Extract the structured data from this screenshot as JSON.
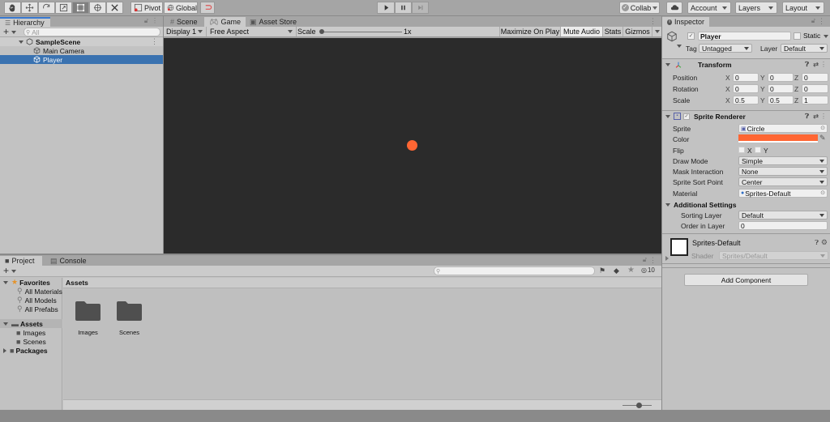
{
  "toolbar": {
    "tools": [
      "hand-tool",
      "move-tool",
      "rotate-tool",
      "scale-tool",
      "rect-tool",
      "transform-tool",
      "custom-tool"
    ],
    "active_tool": "rect-tool",
    "pivot_label": "Pivot",
    "global_label": "Global",
    "play_controls": [
      "play",
      "pause",
      "step"
    ],
    "collab_label": "Collab",
    "account_label": "Account",
    "layers_label": "Layers",
    "layout_label": "Layout"
  },
  "hierarchy": {
    "tab_label": "Hierarchy",
    "search_placeholder": "All",
    "scene_name": "SampleScene",
    "items": [
      {
        "label": "Main Camera",
        "selected": false
      },
      {
        "label": "Player",
        "selected": true
      }
    ]
  },
  "center": {
    "tabs": [
      {
        "label": "Scene",
        "selected": false
      },
      {
        "label": "Game",
        "selected": true
      },
      {
        "label": "Asset Store",
        "selected": false
      }
    ],
    "display_label": "Display 1",
    "aspect_label": "Free Aspect",
    "scale_label": "Scale",
    "scale_value": "1x",
    "maximize_label": "Maximize On Play",
    "mute_label": "Mute Audio",
    "mute_on": true,
    "stats_label": "Stats",
    "gizmos_label": "Gizmos",
    "background_color": "#2b2b2b",
    "sprite_color": "#ff6633"
  },
  "project": {
    "tabs": [
      {
        "label": "Project",
        "selected": true
      },
      {
        "label": "Console",
        "selected": false
      }
    ],
    "favorites_label": "Favorites",
    "favorites": [
      "All Materials",
      "All Models",
      "All Prefabs"
    ],
    "assets_label": "Assets",
    "asset_folders": [
      "Images",
      "Scenes"
    ],
    "packages_label": "Packages",
    "breadcrumb": "Assets",
    "grid_items": [
      "Images",
      "Scenes"
    ],
    "hidden_count": "10"
  },
  "inspector": {
    "tab_label": "Inspector",
    "object_name": "Player",
    "active_checked": true,
    "static_label": "Static",
    "tag_label": "Tag",
    "tag_value": "Untagged",
    "layer_label": "Layer",
    "layer_value": "Default",
    "transform": {
      "title": "Transform",
      "rows": [
        {
          "label": "Position",
          "x": "0",
          "y": "0",
          "z": "0"
        },
        {
          "label": "Rotation",
          "x": "0",
          "y": "0",
          "z": "0"
        },
        {
          "label": "Scale",
          "x": "0.5",
          "y": "0.5",
          "z": "1"
        }
      ]
    },
    "sprite_renderer": {
      "title": "Sprite Renderer",
      "sprite_label": "Sprite",
      "sprite_value": "Circle",
      "color_label": "Color",
      "color_value": "#ff6633",
      "flip_label": "Flip",
      "flip_x": "X",
      "flip_y": "Y",
      "draw_mode_label": "Draw Mode",
      "draw_mode_value": "Simple",
      "mask_label": "Mask Interaction",
      "mask_value": "None",
      "sort_point_label": "Sprite Sort Point",
      "sort_point_value": "Center",
      "material_label": "Material",
      "material_value": "Sprites-Default",
      "additional_label": "Additional Settings",
      "sorting_layer_label": "Sorting Layer",
      "sorting_layer_value": "Default",
      "order_label": "Order in Layer",
      "order_value": "0"
    },
    "material": {
      "name": "Sprites-Default",
      "shader_label": "Shader",
      "shader_value": "Sprites/Default"
    },
    "add_component_label": "Add Component"
  },
  "axis_labels": {
    "x": "X",
    "y": "Y",
    "z": "Z"
  }
}
